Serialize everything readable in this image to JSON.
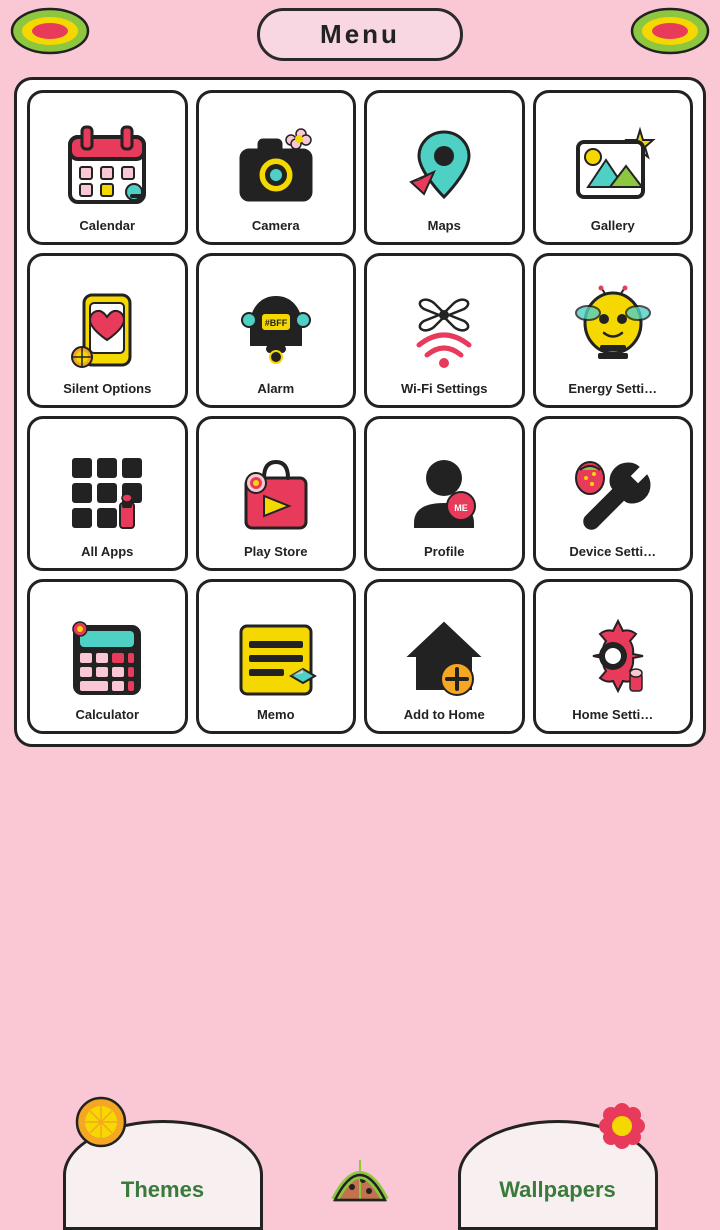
{
  "header": {
    "title": "Menu"
  },
  "apps": [
    {
      "id": "calendar",
      "label": "Calendar",
      "icon": "calendar"
    },
    {
      "id": "camera",
      "label": "Camera",
      "icon": "camera"
    },
    {
      "id": "maps",
      "label": "Maps",
      "icon": "maps"
    },
    {
      "id": "gallery",
      "label": "Gallery",
      "icon": "gallery"
    },
    {
      "id": "silent-options",
      "label": "Silent Options",
      "icon": "silent"
    },
    {
      "id": "alarm",
      "label": "Alarm",
      "icon": "alarm"
    },
    {
      "id": "wifi-settings",
      "label": "Wi-Fi Settings",
      "icon": "wifi"
    },
    {
      "id": "energy-settings",
      "label": "Energy Setti…",
      "icon": "energy"
    },
    {
      "id": "all-apps",
      "label": "All Apps",
      "icon": "allapps"
    },
    {
      "id": "play-store",
      "label": "Play Store",
      "icon": "playstore"
    },
    {
      "id": "profile",
      "label": "Profile",
      "icon": "profile"
    },
    {
      "id": "device-settings",
      "label": "Device Setti…",
      "icon": "device"
    },
    {
      "id": "calculator",
      "label": "Calculator",
      "icon": "calculator"
    },
    {
      "id": "memo",
      "label": "Memo",
      "icon": "memo"
    },
    {
      "id": "add-to-home",
      "label": "Add to Home",
      "icon": "addtohome"
    },
    {
      "id": "home-settings",
      "label": "Home Setti…",
      "icon": "homesettings"
    }
  ],
  "bottom_nav": [
    {
      "id": "themes",
      "label": "Themes"
    },
    {
      "id": "wallpapers",
      "label": "Wallpapers"
    }
  ],
  "colors": {
    "pink": "#f9c8d4",
    "black": "#222222",
    "yellow": "#f5d800",
    "teal": "#4fd0c4",
    "red": "#e83a5a"
  }
}
